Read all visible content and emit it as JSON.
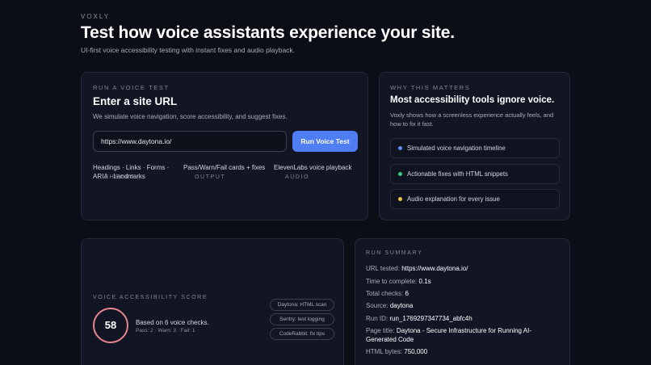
{
  "brand": "VOXLY",
  "hero": {
    "title": "Test how voice assistants experience your site.",
    "subtitle": "UI-first voice accessibility testing with instant fixes and audio playback."
  },
  "run": {
    "eyebrow": "RUN A VOICE TEST",
    "title": "Enter a site URL",
    "description": "We simulate voice navigation, score accessibility, and suggest fixes.",
    "url_value": "https://www.daytona.io/",
    "button_label": "Run Voice Test",
    "meta": [
      {
        "label": "CHECKS",
        "value": "Headings · Links · Forms · ARIA · Landmarks"
      },
      {
        "label": "OUTPUT",
        "value": "Pass/Warn/Fail cards + fixes"
      },
      {
        "label": "AUDIO",
        "value": "ElevenLabs voice playback"
      }
    ]
  },
  "why": {
    "eyebrow": "WHY THIS MATTERS",
    "title": "Most accessibility tools ignore voice.",
    "description": "Voxly shows how a screenless experience actually feels, and how to fix it fast.",
    "items": [
      {
        "label": "Simulated voice navigation timeline",
        "color": "#5b8ef5"
      },
      {
        "label": "Actionable fixes with HTML snippets",
        "color": "#39c98a"
      },
      {
        "label": "Audio explanation for every issue",
        "color": "#f0c24b"
      }
    ]
  },
  "score": {
    "eyebrow": "VOICE ACCESSIBILITY SCORE",
    "value": "58",
    "basis": "Based on 6 voice checks.",
    "detail": "Pass: 2 · Warn: 3 · Fail: 1",
    "ring_color": "#e7868e",
    "tags": [
      "Daytona: HTML scan",
      "Sentry: test logging",
      "CodeRabbit: fix tips"
    ]
  },
  "summary": {
    "eyebrow": "RUN SUMMARY",
    "rows": [
      {
        "label": "URL tested:",
        "value": "https://www.daytona.io/"
      },
      {
        "label": "Time to complete:",
        "value": "0.1s"
      },
      {
        "label": "Total checks:",
        "value": "6"
      },
      {
        "label": "Source:",
        "value": "daytona"
      },
      {
        "label": "Run ID:",
        "value": "run_1769297347734_abfc4h"
      },
      {
        "label": "Page title:",
        "value": "Daytona - Secure Infrastructure for Running AI-Generated Code"
      },
      {
        "label": "HTML bytes:",
        "value": "750,000"
      }
    ]
  }
}
